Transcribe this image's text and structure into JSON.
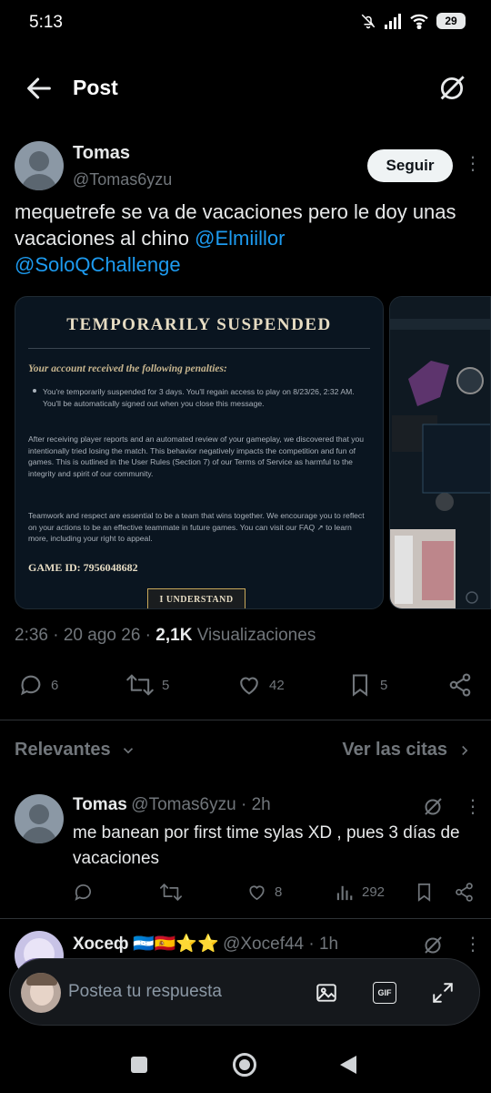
{
  "status_bar": {
    "time": "5:13",
    "battery": "29"
  },
  "header": {
    "title": "Post"
  },
  "post": {
    "author_name": "Tomas",
    "author_handle": "@Tomas6yzu",
    "follow_label": "Seguir",
    "text_plain": "mequetrefe se va de vacaciones pero le doy unas vacaciones al chino ",
    "mention_1": "@Elmiillor",
    "mention_2": "@SoloQChallenge",
    "meta_time": "2:36 · 20 ago 26 · ",
    "meta_views_count": "2,1K",
    "meta_views_label": " Visualizaciones",
    "replies": "6",
    "reposts": "5",
    "likes": "42",
    "bookmarks": "5"
  },
  "media": {
    "title": "TEMPORARILY SUSPENDED",
    "subtitle": "Your account received the following penalties:",
    "bullet": "You're temporarily suspended for 3 days. You'll regain access to play on 8/23/26, 2:32 AM. You'll be automatically signed out when you close this message.",
    "para_1": "After receiving player reports and an automated review of your gameplay, we discovered that you intentionally tried losing the match. This behavior negatively impacts the competition and fun of games. This is outlined in the User Rules (Section 7) of our Terms of Service as harmful to the integrity and spirit of our community.",
    "para_2": "Teamwork and respect are essential to be a team that wins together. We encourage you to reflect on your actions to be an effective teammate in future games. You can visit our FAQ ↗ to learn more, including your right to appeal.",
    "game_id": "GAME ID: 7956048682",
    "button": "I UNDERSTAND"
  },
  "sections": {
    "left": "Relevantes",
    "right": "Ver las citas"
  },
  "replies": [
    {
      "name": "Tomas",
      "handle_time": "@Tomas6yzu · 2h",
      "text": "me banean por first time sylas XD , pues 3 días de vacaciones",
      "likes": "8",
      "views": "292"
    },
    {
      "name": "Хосеф",
      "flags": "🇭🇳🇪🇸⭐⭐",
      "handle_time": "@Xocef44 · 1h"
    }
  ],
  "composer": {
    "placeholder": "Postea tu respuesta",
    "gif_label": "GIF"
  },
  "colors": {
    "background": "#000000",
    "accent": "#1d9bf0",
    "muted": "#71767b",
    "text": "#e7e9ea"
  }
}
